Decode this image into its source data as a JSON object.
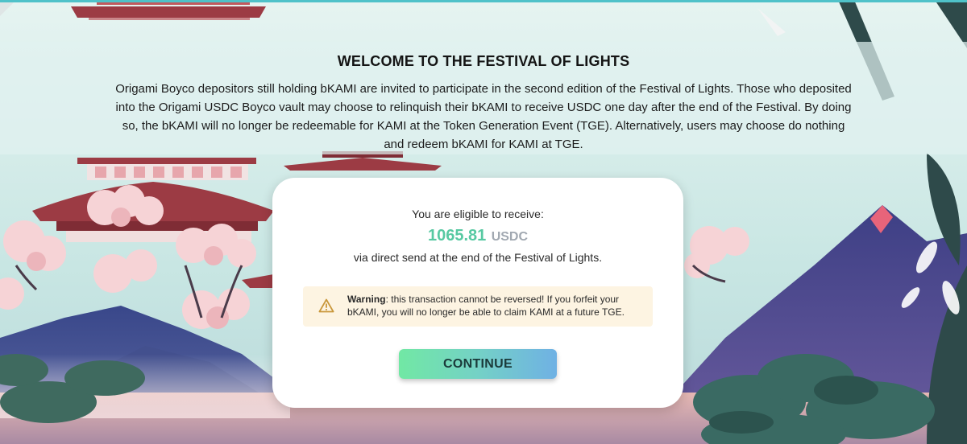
{
  "intro": {
    "title": "WELCOME TO THE FESTIVAL OF LIGHTS",
    "body": "Origami Boyco depositors still holding bKAMI are invited to participate in the second edition of the Festival of Lights. Those who deposited into the Origami USDC Boyco vault may choose to relinquish their bKAMI to receive USDC one day after the end of the Festival. By doing so, the bKAMI will no longer be redeemable for KAMI at the Token Generation Event (TGE). Alternatively, users may choose do nothing and redeem bKAMI for KAMI at TGE."
  },
  "card": {
    "eligible_text": "You are eligible to receive:",
    "amount": "1065.81",
    "unit": "USDC",
    "via_text": "via direct send at the end of the Festival of Lights.",
    "warning": {
      "icon": "warning-triangle-icon",
      "label": "Warning",
      "message": ": this transaction cannot be reversed! If you forfeit your bKAMI, you will no longer be able to claim KAMI at a future TGE."
    },
    "continue_label": "CONTINUE"
  },
  "colors": {
    "accent_green": "#57c9a2",
    "warning_bg": "#fdf4e2",
    "warning_icon": "#c9973a",
    "button_gradient_start": "#71e8a4",
    "button_gradient_end": "#6fb1e4",
    "mountain_purple": "#4a4a8e",
    "pagoda_red": "#9c3b44"
  }
}
